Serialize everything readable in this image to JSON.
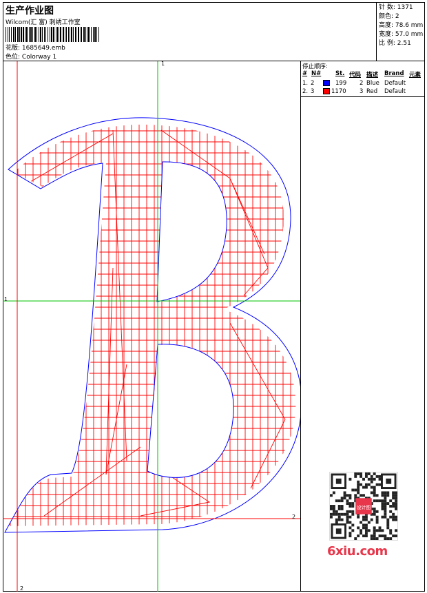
{
  "header": {
    "title": "生产作业图",
    "company": "Wilcom(汇 富) 刺绣工作室",
    "file_label": "花版:",
    "file_name": "1685649.emb",
    "colorway_label": "色位:",
    "colorway_name": "Colorway 1"
  },
  "stats": {
    "stitches": "针 数: 1371",
    "colors": "颜色: 2",
    "height": "高度: 78.6 mm",
    "width": "宽度: 57.0 mm",
    "scale": "比 例: 2.51"
  },
  "stop_sequence": {
    "title": "停止顺序:",
    "columns": {
      "num": "#",
      "n": "N#",
      "st": "St.",
      "code": "代码",
      "desc": "描述",
      "brand": "Brand",
      "element": "元素"
    },
    "rows": [
      {
        "num": "1.",
        "n": "2",
        "color": "#0000ff",
        "st": "199",
        "code": "2",
        "desc": "Blue",
        "brand": "Default"
      },
      {
        "num": "2.",
        "n": "3",
        "color": "#ff0000",
        "st": "1170",
        "code": "3",
        "desc": "Red",
        "brand": "Default"
      }
    ]
  },
  "guides": {
    "top": "1",
    "left": "1",
    "right": "2",
    "bottom": "2"
  },
  "watermark": {
    "text": "6xiu.com",
    "qr_center": "设计图"
  },
  "colors": {
    "outline": "#0000ff",
    "fill": "#ff0000",
    "guide_green": "#00c000",
    "guide_red": "#ff0000"
  }
}
